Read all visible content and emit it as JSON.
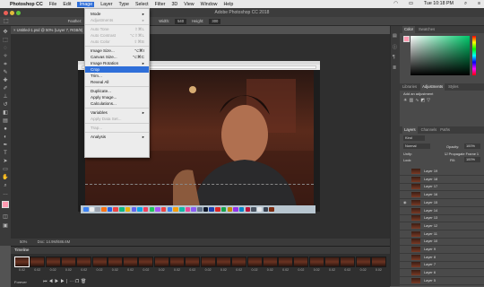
{
  "menubar": {
    "app_name": "Photoshop CC",
    "items": [
      "File",
      "Edit",
      "Image",
      "Layer",
      "Type",
      "Select",
      "Filter",
      "3D",
      "View",
      "Window",
      "Help"
    ],
    "active": "Image",
    "clock": "Tue 10:18 PM"
  },
  "window_title": "Adobe Photoshop CC 2018",
  "options_bar": {
    "feather_label": "Feather:",
    "feather_value": "0 px",
    "width_label": "Width:",
    "width_value": "540",
    "height_label": "Height:",
    "height_value": "300"
  },
  "document_tab": "Untitled-1.psd @ 50% (Layer 7, RGB/8)",
  "image_menu": {
    "items": [
      {
        "label": "Mode",
        "arrow": "▸",
        "disabled": false
      },
      {
        "label": "Adjustments",
        "arrow": "▸",
        "disabled": true
      },
      {
        "sep": true
      },
      {
        "label": "Auto Tone",
        "key": "⇧⌘L",
        "disabled": true
      },
      {
        "label": "Auto Contrast",
        "key": "⌥⇧⌘L",
        "disabled": true
      },
      {
        "label": "Auto Color",
        "key": "⇧⌘B",
        "disabled": true
      },
      {
        "sep": true
      },
      {
        "label": "Image Size...",
        "key": "⌥⌘I",
        "disabled": false
      },
      {
        "label": "Canvas Size...",
        "key": "⌥⌘C",
        "disabled": false
      },
      {
        "label": "Image Rotation",
        "arrow": "▸",
        "disabled": false
      },
      {
        "label": "Crop",
        "disabled": false,
        "highlight": true
      },
      {
        "label": "Trim...",
        "disabled": false
      },
      {
        "label": "Reveal All",
        "disabled": false
      },
      {
        "sep": true
      },
      {
        "label": "Duplicate...",
        "disabled": false
      },
      {
        "label": "Apply Image...",
        "disabled": false
      },
      {
        "label": "Calculations...",
        "disabled": false
      },
      {
        "sep": true
      },
      {
        "label": "Variables",
        "arrow": "▸",
        "disabled": false
      },
      {
        "label": "Apply Data Set...",
        "disabled": true
      },
      {
        "sep": true
      },
      {
        "label": "Trap...",
        "disabled": true
      },
      {
        "sep": true
      },
      {
        "label": "Analysis",
        "arrow": "▸",
        "disabled": false
      }
    ]
  },
  "status_bar": {
    "zoom": "50%",
    "doc_size": "Doc: 14.9M/686.6M"
  },
  "timeline": {
    "title": "Timeline",
    "frame_delay": "0.02",
    "loop": "Forever",
    "frame_count": 24
  },
  "panels": {
    "color_tabs": [
      "Color",
      "Swatches"
    ],
    "adjust_tabs": [
      "Libraries",
      "Adjustments",
      "Styles"
    ],
    "adjust_hint": "Add an adjustment",
    "layer_tabs": [
      "Layers",
      "Channels",
      "Paths"
    ],
    "kind_label": "Kind",
    "blend_mode": "Normal",
    "opacity_label": "Opacity:",
    "opacity_value": "100%",
    "unify_label": "Unify:",
    "propagate_label": "Propagate Frame 1",
    "lock_label": "Lock:",
    "fill_label": "Fill:",
    "fill_value": "100%",
    "layers": [
      "Layer 19",
      "Layer 18",
      "Layer 17",
      "Layer 16",
      "Layer 15",
      "Layer 14",
      "Layer 13",
      "Layer 12",
      "Layer 11",
      "Layer 10",
      "Layer 9",
      "Layer 8",
      "Layer 7",
      "Layer 6",
      "Layer 5"
    ],
    "visible_layer": "Layer 15"
  },
  "colors": {
    "selection_blue": "#2f6fd9",
    "ui_dark": "#535353"
  }
}
